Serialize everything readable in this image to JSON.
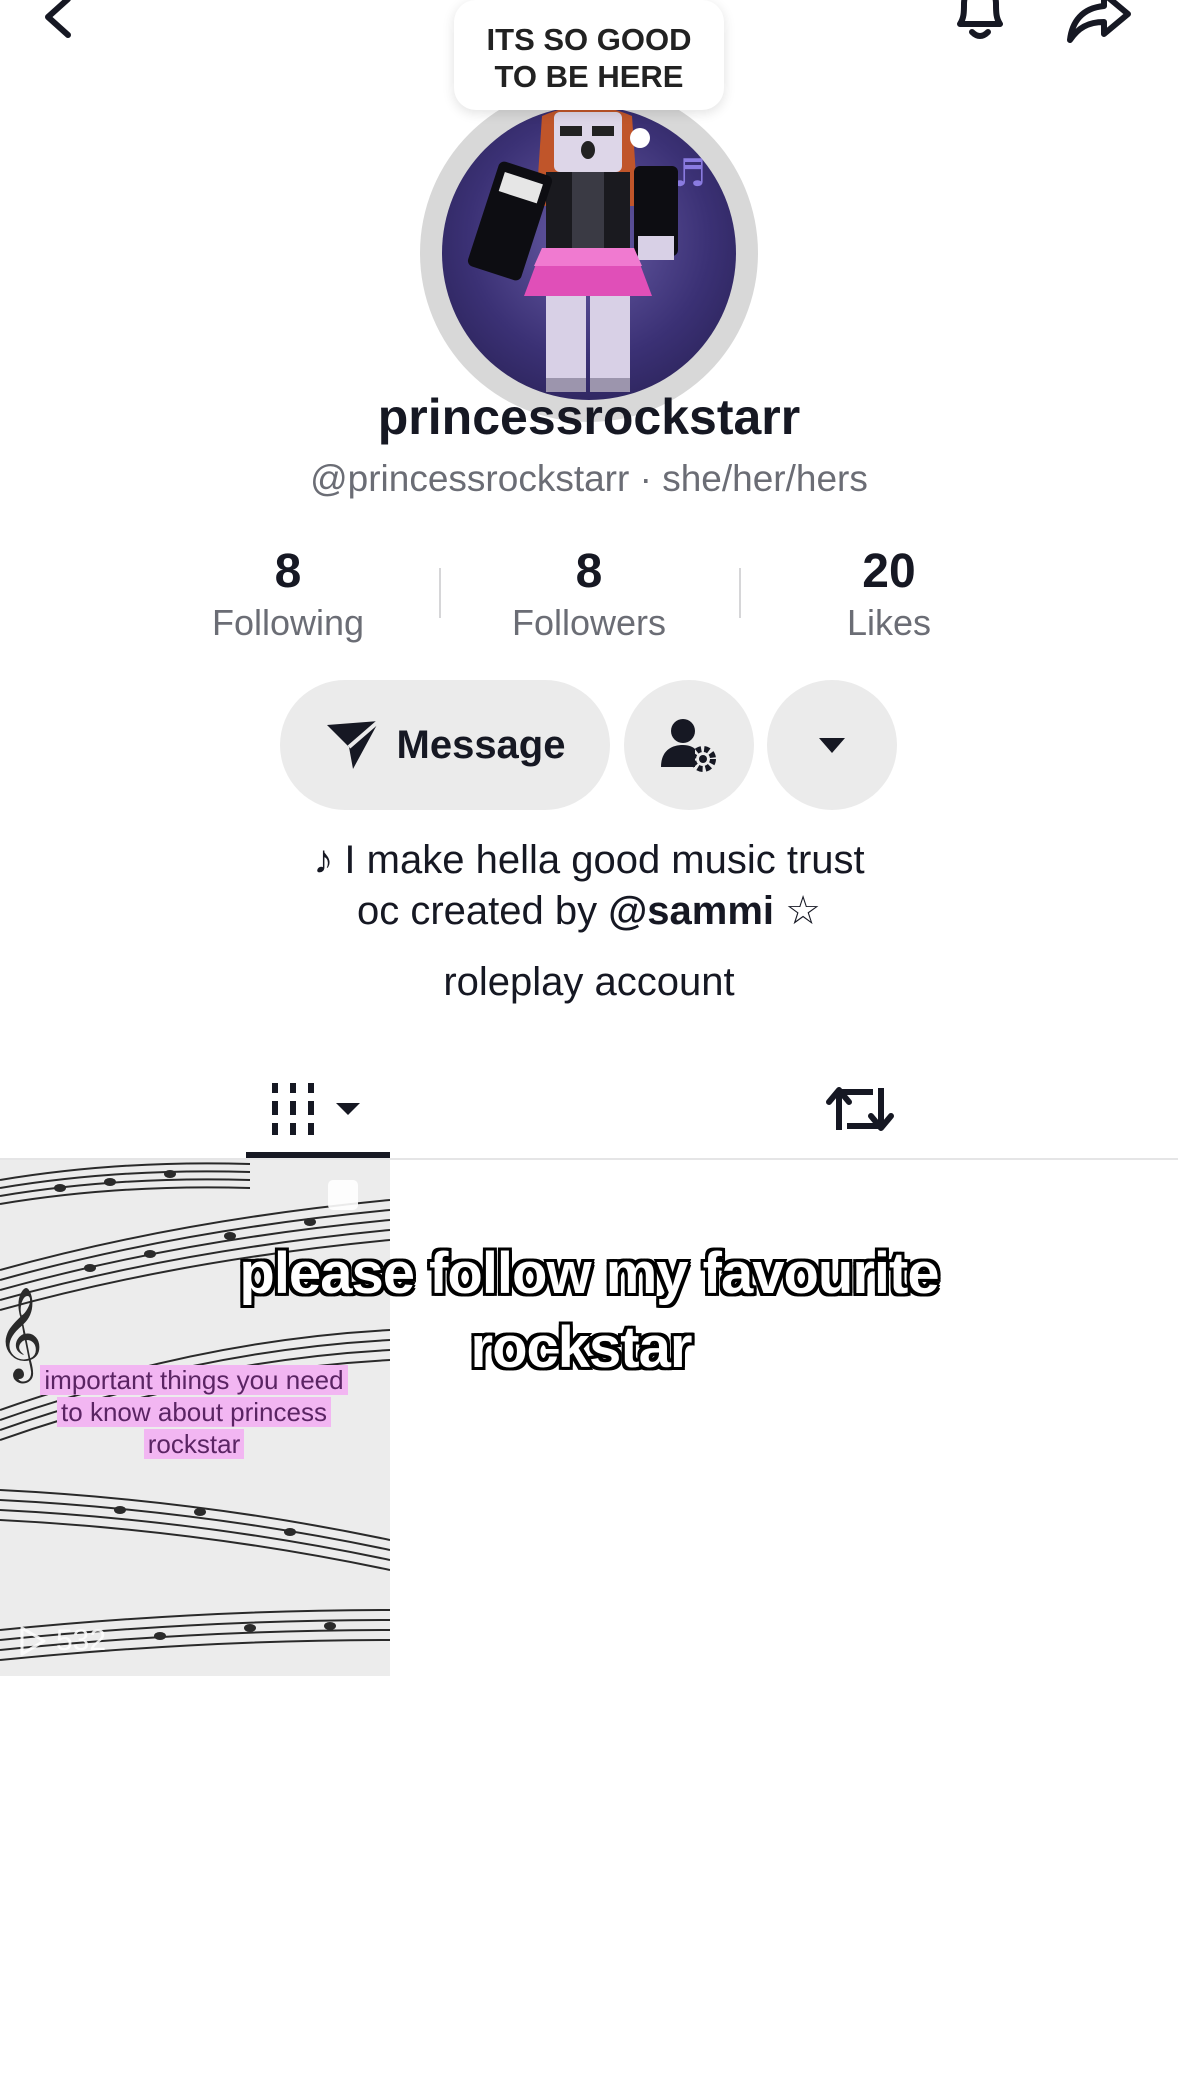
{
  "topbar": {
    "back_icon": "chevron-left-icon",
    "bell_icon": "bell-icon",
    "share_icon": "share-arrow-icon"
  },
  "avatar": {
    "bubble_line1": "ITS SO GOOD",
    "bubble_line2": "TO BE HERE"
  },
  "profile": {
    "name": "princessrockstarr",
    "handle_line": "@princessrockstarr · she/her/hers"
  },
  "stats": [
    {
      "value": "8",
      "label": "Following"
    },
    {
      "value": "8",
      "label": "Followers"
    },
    {
      "value": "20",
      "label": "Likes"
    }
  ],
  "actions": {
    "message_label": "Message",
    "message_icon": "send-icon",
    "friend_settings_icon": "user-gear-icon",
    "more_icon": "caret-down-icon"
  },
  "bio": {
    "line1": "♪ I make hella good music trust",
    "line2_prefix": "oc created by ",
    "line2_mention": "@sammi",
    "line2_suffix": " ☆",
    "line3": "roleplay account"
  },
  "tabs": [
    {
      "name": "videos",
      "icon": "grid-bars-icon",
      "active": true
    },
    {
      "name": "reposts",
      "icon": "repost-icon",
      "active": false
    }
  ],
  "video": {
    "caption": "important things you need to know about princess rockstar",
    "caption_lines": [
      "important things you need",
      "to know about princess",
      "rockstar"
    ],
    "views": "532"
  },
  "overlay": {
    "line1": "please follow my favourite",
    "line2": "rockstar"
  },
  "colors": {
    "text_primary": "#161823",
    "text_secondary": "#6b6d75",
    "button_bg": "#ebebeb",
    "highlight_pink": "#f2b6f2"
  }
}
